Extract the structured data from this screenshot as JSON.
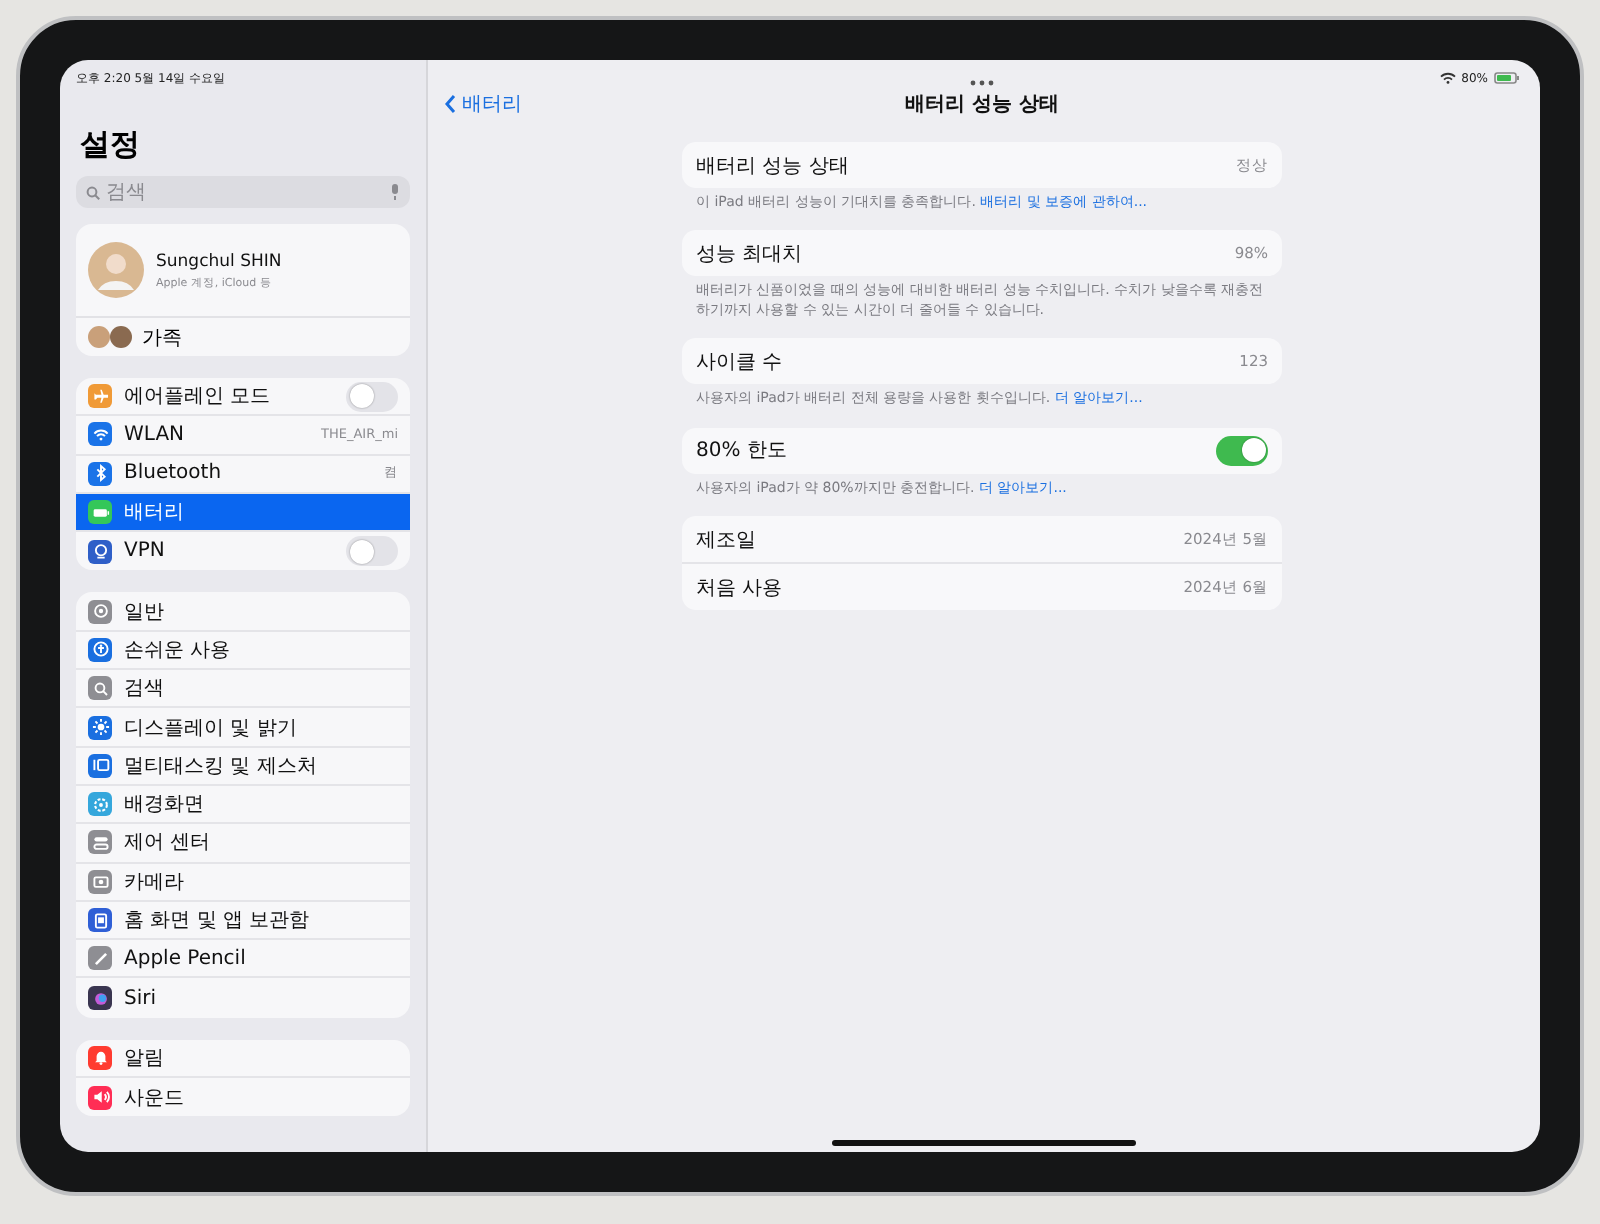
{
  "status_bar": {
    "time_date": "오후 2:20  5월 14일 수요일",
    "battery": "80%"
  },
  "sidebar": {
    "title": "설정",
    "search": {
      "placeholder": "검색"
    },
    "profile": {
      "name": "Sungchul SHIN",
      "subtitle": "Apple 계정, iCloud 등",
      "family": "가족"
    },
    "groups": [
      [
        {
          "label": "에어플레인 모드",
          "kind": "toggle",
          "on": false,
          "color": "#f09a37",
          "selected": false
        },
        {
          "label": "WLAN",
          "kind": "value",
          "value": "THE_AIR_mi",
          "color": "#1a73e8",
          "selected": false
        },
        {
          "label": "Bluetooth",
          "kind": "value",
          "value": "켬",
          "color": "#1a73e8",
          "selected": false
        },
        {
          "label": "배터리",
          "kind": "plain",
          "color": "#34c759",
          "selected": true
        },
        {
          "label": "VPN",
          "kind": "toggle",
          "on": false,
          "color": "#2f5fc8",
          "selected": false
        }
      ],
      [
        {
          "label": "일반",
          "kind": "plain",
          "color": "#8e8e93",
          "selected": false
        },
        {
          "label": "손쉬운 사용",
          "kind": "plain",
          "color": "#1a6fe0",
          "selected": false
        },
        {
          "label": "검색",
          "kind": "plain",
          "color": "#8e8e93",
          "selected": false
        },
        {
          "label": "디스플레이 및 밝기",
          "kind": "plain",
          "color": "#1a6fe0",
          "selected": false
        },
        {
          "label": "멀티태스킹 및 제스처",
          "kind": "plain",
          "color": "#1a6fe0",
          "selected": false
        },
        {
          "label": "배경화면",
          "kind": "plain",
          "color": "#35a7dc",
          "selected": false
        },
        {
          "label": "제어 센터",
          "kind": "plain",
          "color": "#8e8e93",
          "selected": false
        },
        {
          "label": "카메라",
          "kind": "plain",
          "color": "#8e8e93",
          "selected": false
        },
        {
          "label": "홈 화면 및 앱 보관함",
          "kind": "plain",
          "color": "#2f5fd6",
          "selected": false
        },
        {
          "label": "Apple Pencil",
          "kind": "plain",
          "color": "#8e8e93",
          "selected": false
        },
        {
          "label": "Siri",
          "kind": "plain",
          "color": "#3a3550",
          "selected": false
        }
      ],
      [
        {
          "label": "알림",
          "kind": "plain",
          "color": "#ff3b30",
          "selected": false
        },
        {
          "label": "사운드",
          "kind": "plain",
          "color": "#ff2d55",
          "selected": false
        }
      ]
    ]
  },
  "detail": {
    "back": "배터리",
    "title": "배터리 성능 상태",
    "sections": [
      {
        "rows": [
          {
            "label": "배터리 성능 상태",
            "kind": "value",
            "value": "정상"
          }
        ],
        "footer": "이 iPad 배터리 성능이 기대치를 충족합니다. ",
        "footer_link": "배터리 및 보증에 관하여..."
      },
      {
        "rows": [
          {
            "label": "성능 최대치",
            "kind": "value",
            "value": "98%"
          }
        ],
        "footer": "배터리가 신품이었을 때의 성능에 대비한 배터리 성능 수치입니다. 수치가 낮을수록 재충전하기까지 사용할 수 있는 시간이 더 줄어들 수 있습니다."
      },
      {
        "rows": [
          {
            "label": "사이클 수",
            "kind": "value",
            "value": "123"
          }
        ],
        "footer": "사용자의 iPad가 배터리 전체 용량을 사용한 횟수입니다. ",
        "footer_link": "더 알아보기..."
      },
      {
        "rows": [
          {
            "label": "80% 한도",
            "kind": "toggle",
            "on": true
          }
        ],
        "footer": "사용자의 iPad가 약 80%까지만 충전합니다. ",
        "footer_link": "더 알아보기..."
      },
      {
        "rows": [
          {
            "label": "제조일",
            "kind": "value",
            "value": "2024년 5월"
          },
          {
            "label": "처음 사용",
            "kind": "value",
            "value": "2024년 6월"
          }
        ]
      }
    ]
  }
}
